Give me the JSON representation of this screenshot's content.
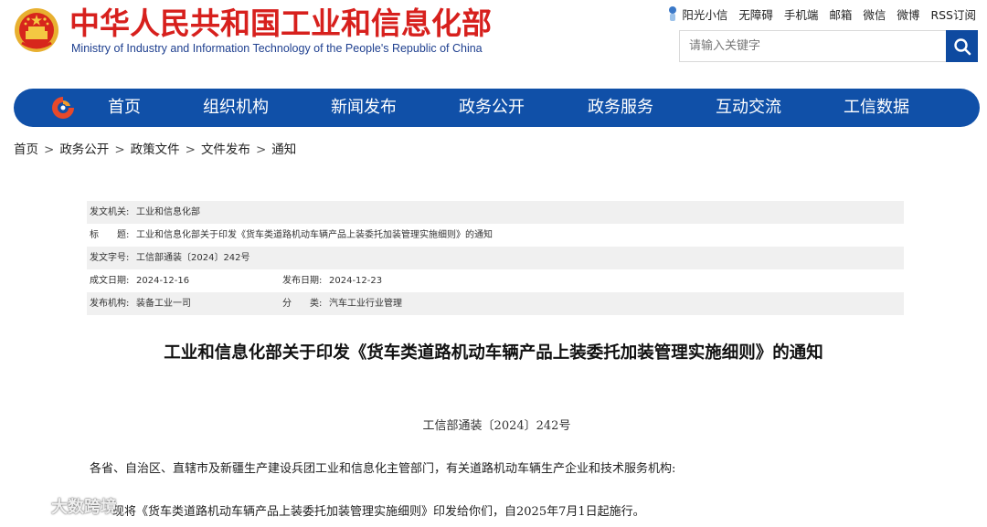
{
  "header": {
    "title_cn": "中华人民共和国工业和信息化部",
    "title_en": "Ministry of Industry and Information Technology of the People's Republic of China",
    "links": [
      "阳光小信",
      "无障碍",
      "手机端",
      "邮箱",
      "微信",
      "微博",
      "RSS订阅"
    ],
    "search_placeholder": "请输入关键字"
  },
  "nav": {
    "items": [
      "首页",
      "组织机构",
      "新闻发布",
      "政务公开",
      "政务服务",
      "互动交流",
      "工信数据"
    ]
  },
  "breadcrumb": [
    "首页",
    "政务公开",
    "政策文件",
    "文件发布",
    "通知"
  ],
  "meta": {
    "issuer_label": "发文机关:",
    "issuer": "工业和信息化部",
    "title_label": "标　　题:",
    "title": "工业和信息化部关于印发《货车类道路机动车辆产品上装委托加装管理实施细则》的通知",
    "docno_label": "发文字号:",
    "docno": "工信部通装〔2024〕242号",
    "written_label": "成文日期:",
    "written": "2024-12-16",
    "published_label": "发布日期:",
    "published": "2024-12-23",
    "office_label": "发布机构:",
    "office": "装备工业一司",
    "category_label": "分　　类:",
    "category": "汽车工业行业管理"
  },
  "article": {
    "title": "工业和信息化部关于印发《货车类道路机动车辆产品上装委托加装管理实施细则》的通知",
    "doc_number": "工信部通装〔2024〕242号",
    "para1": "各省、自治区、直辖市及新疆生产建设兵团工业和信息化主管部门，有关道路机动车辆生产企业和技术服务机构:",
    "para2": "现将《货车类道路机动车辆产品上装委托加装管理实施细则》印发给你们，自2025年7月1日起施行。"
  },
  "watermark": "大数跨境",
  "colors": {
    "brand_red": "#d7201d",
    "brand_blue": "#1050a8",
    "search_button": "#0e4aa0",
    "meta_row_shade": "#f0f0f0"
  }
}
